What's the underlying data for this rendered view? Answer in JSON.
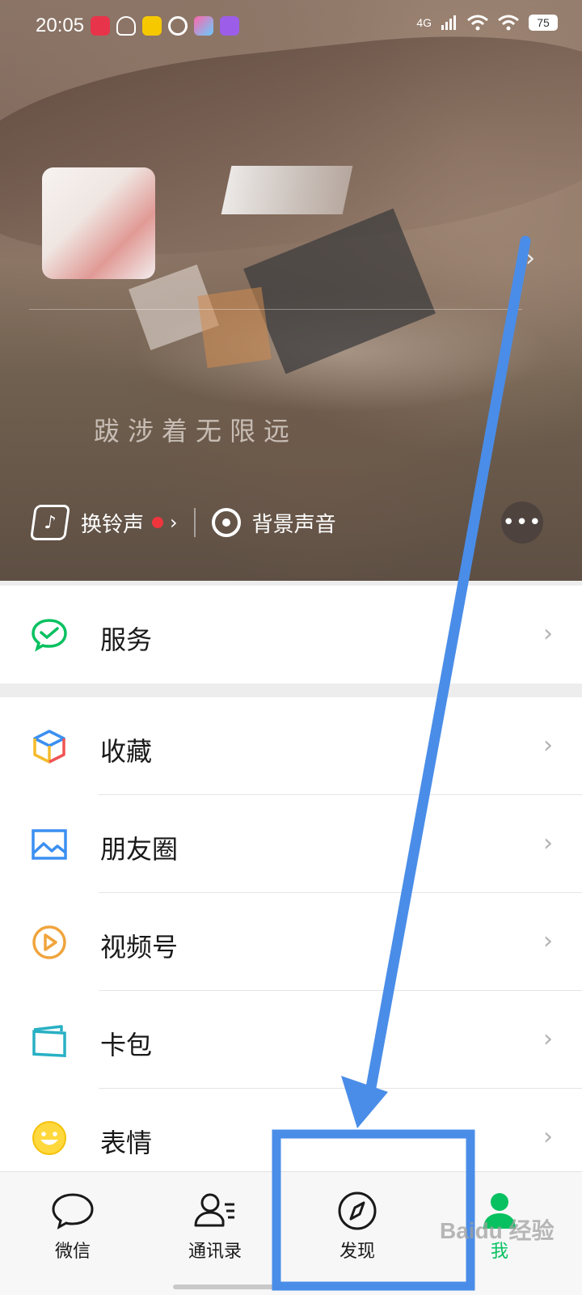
{
  "status_bar": {
    "time": "20:05",
    "network": "4G",
    "battery": "75"
  },
  "profile": {
    "signature": "跋涉着无限远"
  },
  "hero_actions": {
    "ringtone": "换铃声",
    "background_sound": "背景声音"
  },
  "menu": {
    "services": "服务",
    "favorites": "收藏",
    "moments": "朋友圈",
    "channels": "视频号",
    "cards": "卡包",
    "stickers": "表情"
  },
  "tab_bar": {
    "tabs": [
      {
        "label": "微信",
        "icon": "chat-bubble-icon"
      },
      {
        "label": "通讯录",
        "icon": "contacts-icon"
      },
      {
        "label": "发现",
        "icon": "compass-icon"
      },
      {
        "label": "我",
        "icon": "person-icon"
      }
    ]
  },
  "colors": {
    "accent": "#07c160",
    "annotation": "#4a8de8"
  },
  "watermark": "Baidu 经验"
}
